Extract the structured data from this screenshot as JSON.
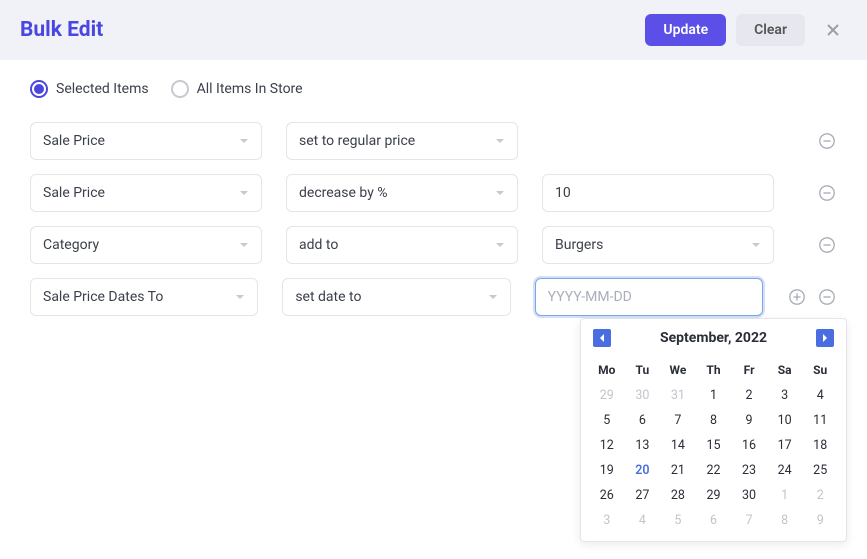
{
  "header": {
    "title": "Bulk Edit",
    "update_label": "Update",
    "clear_label": "Clear"
  },
  "scope": {
    "options": [
      {
        "label": "Selected Items",
        "checked": true
      },
      {
        "label": "All Items In Store",
        "checked": false
      }
    ]
  },
  "rows": [
    {
      "field": "Sale Price",
      "action": "set to regular price",
      "value_type": "none",
      "value": ""
    },
    {
      "field": "Sale Price",
      "action": "decrease by %",
      "value_type": "text",
      "value": "10"
    },
    {
      "field": "Category",
      "action": "add to",
      "value_type": "select",
      "value": "Burgers"
    },
    {
      "field": "Sale Price Dates To",
      "action": "set date to",
      "value_type": "date",
      "value": "",
      "placeholder": "YYYY-MM-DD",
      "active": true
    }
  ],
  "datepicker": {
    "title": "September, 2022",
    "weekday_headers": [
      "Mo",
      "Tu",
      "We",
      "Th",
      "Fr",
      "Sa",
      "Su"
    ],
    "cells": [
      {
        "d": "29",
        "out": true
      },
      {
        "d": "30",
        "out": true
      },
      {
        "d": "31",
        "out": true
      },
      {
        "d": "1"
      },
      {
        "d": "2"
      },
      {
        "d": "3"
      },
      {
        "d": "4"
      },
      {
        "d": "5"
      },
      {
        "d": "6"
      },
      {
        "d": "7"
      },
      {
        "d": "8"
      },
      {
        "d": "9"
      },
      {
        "d": "10"
      },
      {
        "d": "11"
      },
      {
        "d": "12"
      },
      {
        "d": "13"
      },
      {
        "d": "14"
      },
      {
        "d": "15"
      },
      {
        "d": "16"
      },
      {
        "d": "17"
      },
      {
        "d": "18"
      },
      {
        "d": "19"
      },
      {
        "d": "20",
        "today": true
      },
      {
        "d": "21"
      },
      {
        "d": "22"
      },
      {
        "d": "23"
      },
      {
        "d": "24"
      },
      {
        "d": "25"
      },
      {
        "d": "26"
      },
      {
        "d": "27"
      },
      {
        "d": "28"
      },
      {
        "d": "29"
      },
      {
        "d": "30"
      },
      {
        "d": "1",
        "out": true
      },
      {
        "d": "2",
        "out": true
      },
      {
        "d": "3",
        "out": true
      },
      {
        "d": "4",
        "out": true
      },
      {
        "d": "5",
        "out": true
      },
      {
        "d": "6",
        "out": true
      },
      {
        "d": "7",
        "out": true
      },
      {
        "d": "8",
        "out": true
      },
      {
        "d": "9",
        "out": true
      }
    ]
  }
}
